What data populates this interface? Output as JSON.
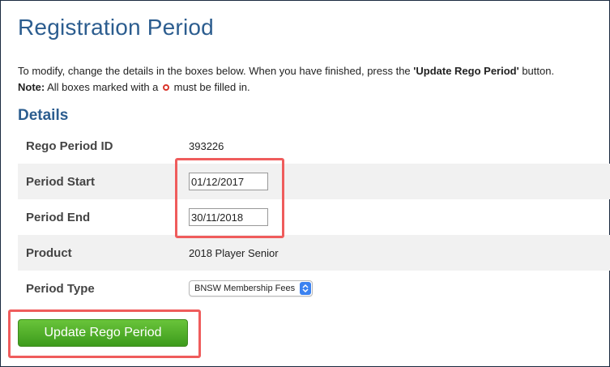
{
  "page": {
    "title": "Registration Period",
    "instruction_prefix": "To modify, change the details in the boxes below. When you have finished, press the ",
    "instruction_button_ref": "'Update Rego Period'",
    "instruction_suffix": " button.",
    "note_label": "Note:",
    "note_prefix": " All boxes marked with a ",
    "note_suffix": " must be filled in.",
    "section_title": "Details"
  },
  "fields": {
    "rego_period_id": {
      "label": "Rego Period ID",
      "value": "393226"
    },
    "period_start": {
      "label": "Period Start",
      "value": "01/12/2017"
    },
    "period_end": {
      "label": "Period End",
      "value": "30/11/2018"
    },
    "product": {
      "label": "Product",
      "value": "2018 Player Senior"
    },
    "period_type": {
      "label": "Period Type",
      "selected": "BNSW Membership Fees"
    }
  },
  "actions": {
    "update_label": "Update Rego Period"
  },
  "colors": {
    "heading": "#2c5d8f",
    "required_marker": "#d9362d",
    "highlight": "#ef5c5c",
    "button_green": "#4fae28",
    "row_shade": "#f1f1f1"
  }
}
